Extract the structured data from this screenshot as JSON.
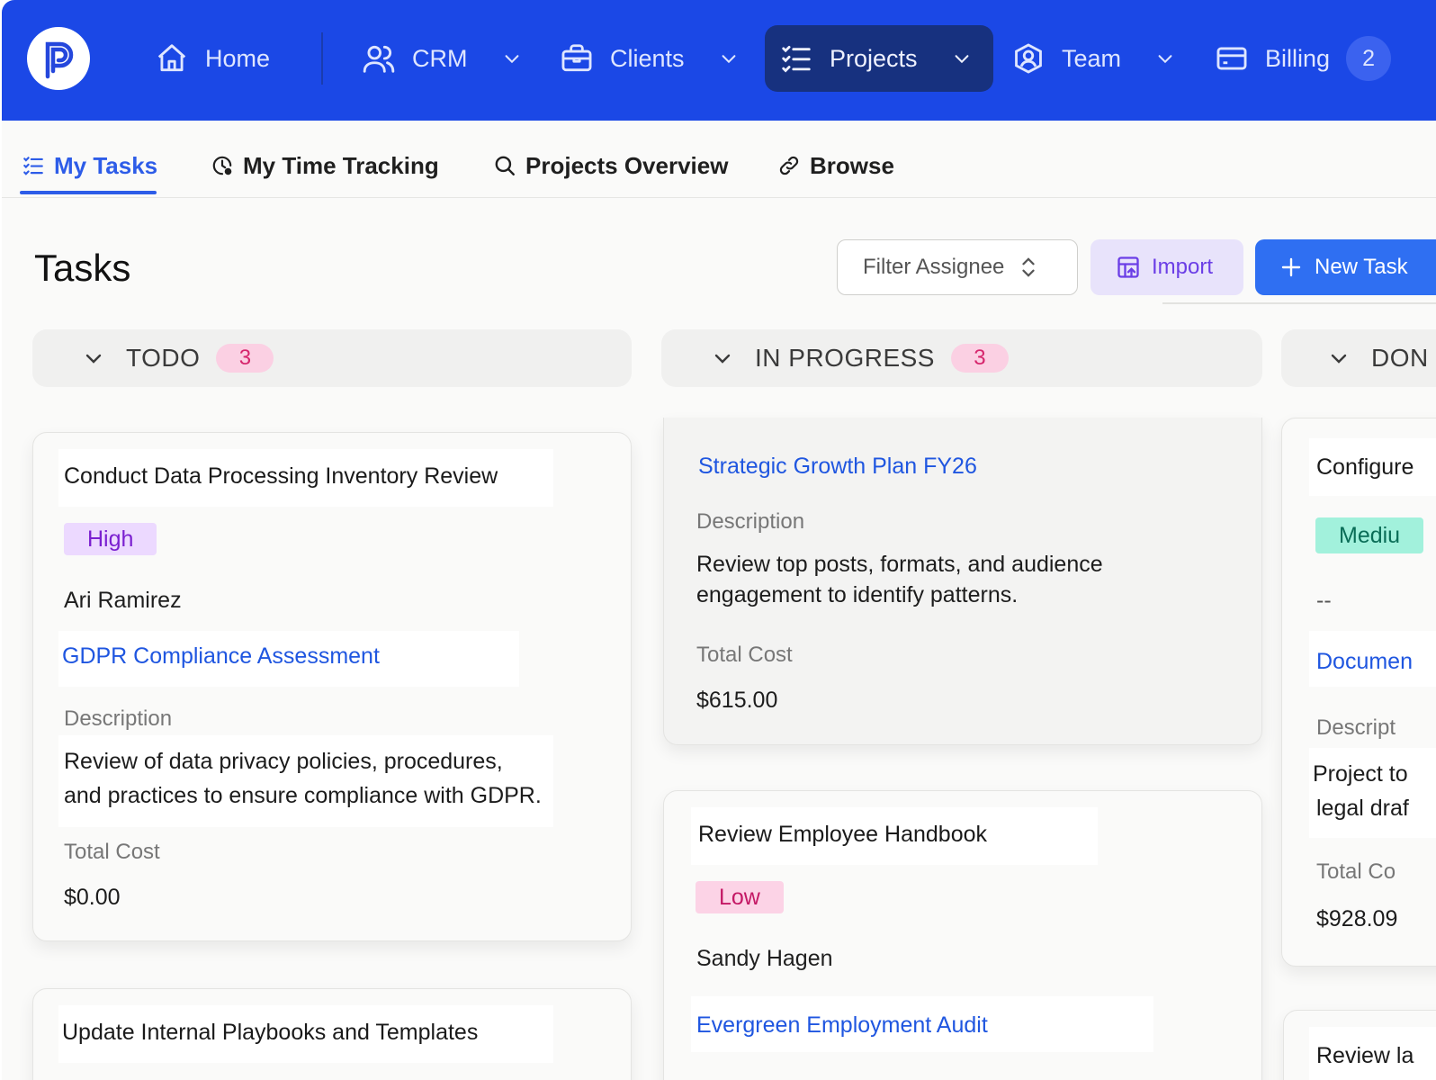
{
  "nav": {
    "items": [
      {
        "label": "Home",
        "icon": "home-icon"
      },
      {
        "label": "CRM",
        "icon": "users-icon"
      },
      {
        "label": "Clients",
        "icon": "briefcase-icon"
      },
      {
        "label": "Projects",
        "icon": "list-checks-icon"
      },
      {
        "label": "Team",
        "icon": "user-circle-icon"
      },
      {
        "label": "Billing",
        "icon": "credit-card-icon",
        "badge": "2"
      }
    ],
    "active": "Projects",
    "colors": {
      "bar": "#1b48e6",
      "active": "#17317f"
    }
  },
  "subtabs": {
    "items": [
      {
        "label": "My Tasks",
        "icon": "list-checks-icon"
      },
      {
        "label": "My Time Tracking",
        "icon": "clock-icon"
      },
      {
        "label": "Projects Overview",
        "icon": "search-icon"
      },
      {
        "label": "Browse",
        "icon": "link-icon"
      }
    ],
    "active": "My Tasks"
  },
  "page": {
    "title": "Tasks",
    "filter_label": "Filter Assignee",
    "import_label": "Import",
    "new_task_label": "New Task"
  },
  "columns": [
    {
      "label": "TODO",
      "count": "3",
      "cards": [
        {
          "title": "Conduct Data Processing Inventory Review",
          "priority": "High",
          "assignee": "Ari Ramirez",
          "project": "GDPR Compliance Assessment",
          "description_label": "Description",
          "description_line1": "Review of data privacy policies, procedures,",
          "description_line2": "and practices to ensure compliance with GDPR.",
          "cost_label": "Total Cost",
          "cost": "$0.00"
        },
        {
          "title": "Update Internal Playbooks and Templates"
        }
      ]
    },
    {
      "label": "IN PROGRESS",
      "count": "3",
      "cards": [
        {
          "project": "Strategic Growth Plan FY26",
          "description_label": "Description",
          "description_line1": "Review top posts, formats, and audience",
          "description_line2": "engagement to identify patterns.",
          "cost_label": "Total Cost",
          "cost": "$615.00"
        },
        {
          "title": "Review Employee Handbook",
          "priority": "Low",
          "assignee": "Sandy Hagen",
          "project": "Evergreen Employment Audit"
        }
      ]
    },
    {
      "label": "DON",
      "cards": [
        {
          "title": "Configure",
          "priority": "Mediu",
          "assignee": "--",
          "project": "Documen",
          "description_label": "Descript",
          "description_line1": "Project to",
          "description_line2": "legal draf",
          "cost_label": "Total Co",
          "cost": "$928.09"
        },
        {
          "title": "Review la"
        }
      ]
    }
  ],
  "theme": {
    "accent": "#2f6ff2",
    "priority_high": "#ecd9ff",
    "priority_low": "#fcd3e6",
    "priority_medium": "#a2f1dc",
    "count_pill": "#fbd0e3"
  }
}
